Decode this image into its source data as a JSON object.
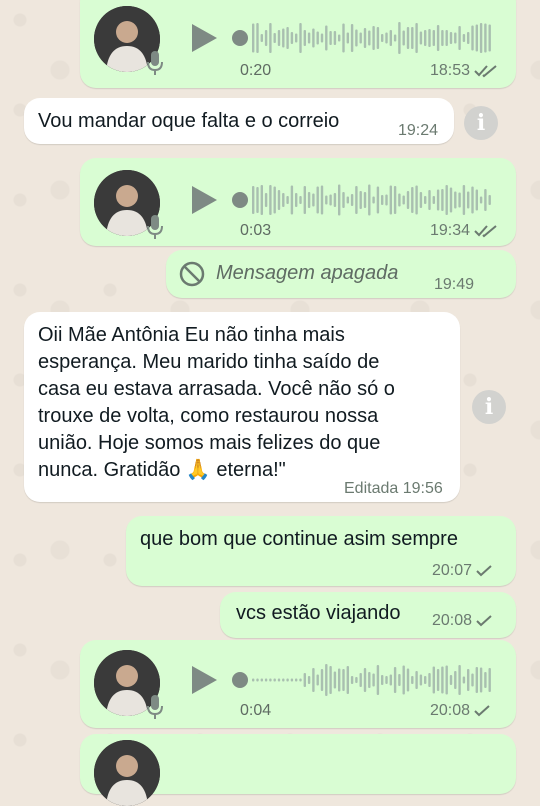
{
  "messages": [
    {
      "type": "audio",
      "duration": "0:20",
      "time": "18:53",
      "status": "read"
    },
    {
      "type": "text",
      "text": "Vou mandar oque falta e o correio",
      "time": "19:24"
    },
    {
      "type": "audio",
      "duration": "0:03",
      "time": "19:34",
      "status": "read"
    },
    {
      "type": "deleted",
      "text": "Mensagem apagada",
      "time": "19:49"
    },
    {
      "type": "text_long",
      "lines": [
        "Oii Mãe Antônia Eu não tinha mais",
        "esperança. Meu marido tinha saído de",
        "casa eu estava arrasada. Você não só o",
        "trouxe de volta, como restaurou nossa",
        "união. Hoje somos mais felizes do que",
        "nunca. Gratidão",
        "eterna!\""
      ],
      "emoji": "🙏",
      "edited_label": "Editada",
      "time": "19:56"
    },
    {
      "type": "text",
      "text": "que bom que continue asim sempre",
      "time": "20:07",
      "status": "sent"
    },
    {
      "type": "text",
      "text": "vcs estão viajando",
      "time": "20:08",
      "status": "sent"
    },
    {
      "type": "audio",
      "duration": "0:04",
      "time": "20:08",
      "status": "sent"
    },
    {
      "type": "audio_partial"
    }
  ],
  "icons": {
    "info": "info-icon",
    "play": "play-icon",
    "mic": "microphone-icon",
    "deleted": "blocked-icon"
  },
  "colors": {
    "outgoing": "#d9fdd3",
    "incoming": "#ffffff",
    "read_ticks": "#53bdeb",
    "background": "#efe7dd"
  }
}
